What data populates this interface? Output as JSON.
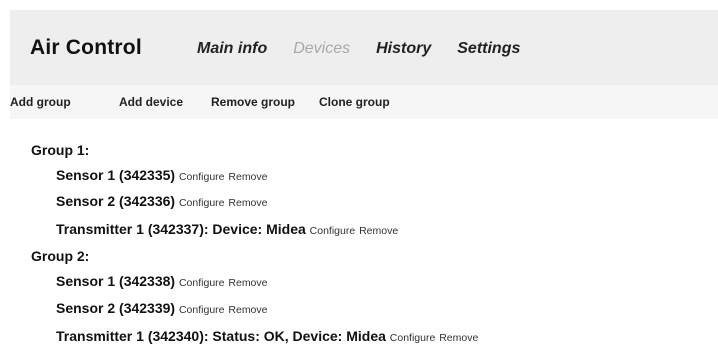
{
  "app": {
    "title": "Air Control"
  },
  "nav": {
    "items": [
      {
        "label": "Main info"
      },
      {
        "label": "Devices"
      },
      {
        "label": "History"
      },
      {
        "label": "Settings"
      }
    ]
  },
  "toolbar": {
    "add_group": "Add group",
    "add_device": "Add device",
    "remove_group": "Remove group",
    "clone_group": "Clone group"
  },
  "groups": [
    {
      "label": "Group 1:",
      "devices": [
        {
          "name": "Sensor 1 (342335)",
          "configure": "Configure",
          "remove": "Remove"
        },
        {
          "name": "Sensor 2 (342336)",
          "configure": "Configure",
          "remove": "Remove"
        },
        {
          "name": "Transmitter 1 (342337): Device: Midea",
          "configure": "Configure",
          "remove": "Remove"
        }
      ]
    },
    {
      "label": "Group 2:",
      "devices": [
        {
          "name": "Sensor 1 (342338)",
          "configure": "Configure",
          "remove": "Remove"
        },
        {
          "name": "Sensor 2 (342339)",
          "configure": "Configure",
          "remove": "Remove"
        },
        {
          "name": "Transmitter 1 (342340): Status: OK, Device: Midea",
          "configure": "Configure",
          "remove": "Remove"
        }
      ]
    }
  ]
}
